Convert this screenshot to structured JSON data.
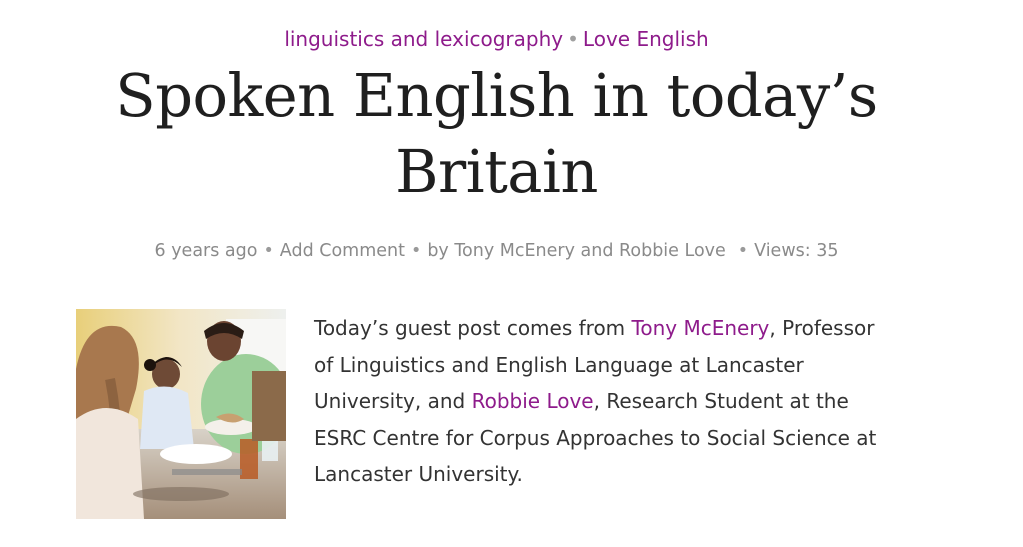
{
  "categories": {
    "first": "linguistics and lexicography",
    "separator": "•",
    "second": "Love English"
  },
  "post": {
    "title_line1": "Spoken English in today’s",
    "title_line2": "Britain"
  },
  "meta": {
    "age": "6 years ago",
    "separator": "•",
    "comment_link": "Add Comment",
    "byline": "by Tony McEnery and Robbie Love",
    "views": "Views: 35"
  },
  "image": {
    "alt": "family-dinner-photo"
  },
  "intro": {
    "l1_pre": "Today’s guest post comes from ",
    "l1_link": "Tony McEnery",
    "l1_post": ", Professor",
    "l2": "of Linguistics and English Language at Lancaster",
    "l3_pre": "University, and ",
    "l3_link": "Robbie Love",
    "l3_post": ", Research Student at the",
    "l4": "ESRC Centre for Corpus Approaches to Social Science at",
    "l5": "Lancaster University."
  },
  "colors": {
    "link": "#8e1b8b",
    "meta": "#8a8a8a",
    "title": "#1f1f1f",
    "body": "#333333"
  }
}
